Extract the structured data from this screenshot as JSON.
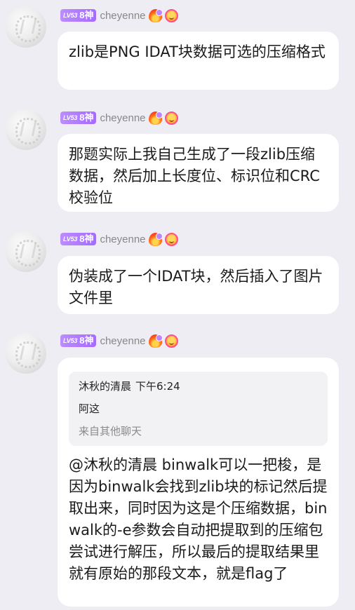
{
  "messages": [
    {
      "avatar": "avatar",
      "level": "LV53",
      "rank": "8神",
      "username": "cheyenne",
      "badges": [
        "fire-icon",
        "smile-icon"
      ],
      "text": "zlib是PNG IDAT块数据可选的压缩格式"
    },
    {
      "avatar": "avatar",
      "level": "LV53",
      "rank": "8神",
      "username": "cheyenne",
      "badges": [
        "fire-icon",
        "smile-icon"
      ],
      "text": "那题实际上我自己生成了一段zlib压缩数据，然后加上长度位、标识位和CRC校验位"
    },
    {
      "avatar": "avatar",
      "level": "LV53",
      "rank": "8神",
      "username": "cheyenne",
      "badges": [
        "fire-icon",
        "smile-icon"
      ],
      "text": "伪装成了一个IDAT块，然后插入了图片文件里"
    },
    {
      "avatar": "avatar",
      "level": "LV53",
      "rank": "8神",
      "username": "cheyenne",
      "badges": [
        "fire-icon",
        "smile-icon"
      ],
      "quote": {
        "author": "沐秋的清晨",
        "time": "下午6:24",
        "text": "阿这",
        "source": "来自其他聊天"
      },
      "text": "@沐秋的清晨 binwalk可以一把梭，是因为binwalk会找到zlib块的标记然后提取出来，同时因为这是个压缩数据，binwalk的-e参数会自动把提取到的压缩包尝试进行解压，所以最后的提取结果里就有原始的那段文本，就是flag了"
    }
  ]
}
